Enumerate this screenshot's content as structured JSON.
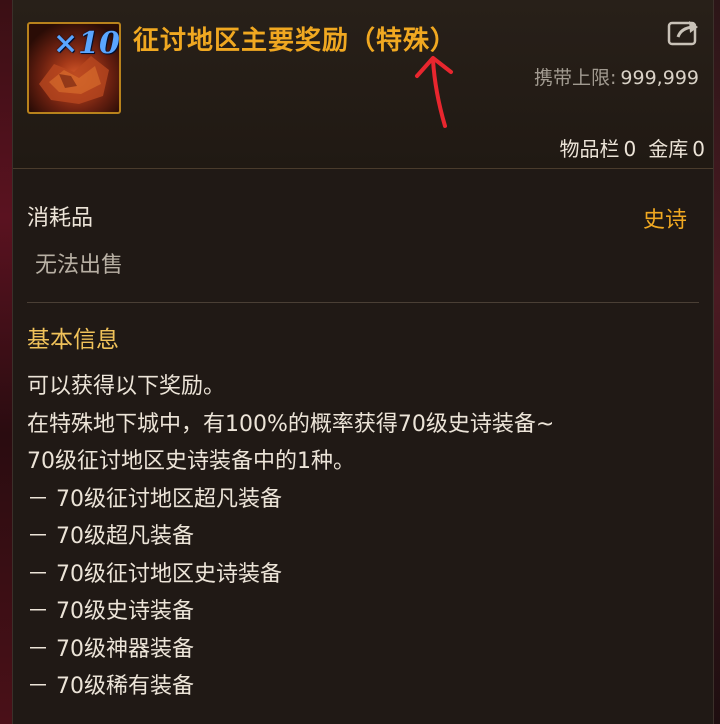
{
  "item": {
    "stack_count": "×10",
    "name": "征讨地区主要奖励（特殊）",
    "carry_limit_label": "携带上限:",
    "carry_limit_value": "999,999",
    "inventory_label": "物品栏",
    "inventory_count": "0",
    "storage_label": "金库",
    "storage_count": "0",
    "type": "消耗品",
    "rarity": "史诗",
    "sell_status": "无法出售"
  },
  "info": {
    "title": "基本信息",
    "lines": [
      "可以获得以下奖励。",
      "在特殊地下城中，有100%的概率获得70级史诗装备~",
      "70级征讨地区史诗装备中的1种。",
      "－ 70级征讨地区超凡装备",
      "－ 70级超凡装备",
      "－ 70级征讨地区史诗装备",
      "－ 70级史诗装备",
      "－ 70级神器装备",
      "－ 70级稀有装备"
    ]
  },
  "colors": {
    "name": "#f0a821",
    "rarity": "#f0a821",
    "info_title": "#f0c25a",
    "stack": "#5aa6ff",
    "annotation_arrow": "#e8262e"
  },
  "icons": {
    "share": "external-share-icon",
    "annotation": "red-up-arrow"
  }
}
